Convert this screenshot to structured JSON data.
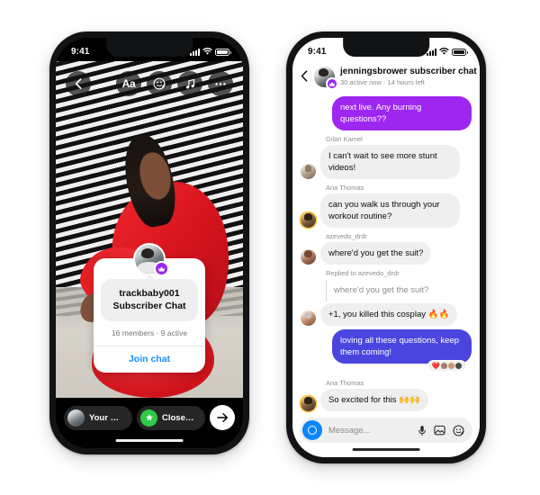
{
  "left_phone": {
    "status_bar": {
      "time": "9:41",
      "signal_icon": "cellular-bars-icon",
      "wifi_icon": "wifi-icon",
      "battery_icon": "battery-icon"
    },
    "story": {
      "back_icon": "chevron-left-icon",
      "tools": [
        {
          "name": "text-tool",
          "label": "Aa",
          "icon": "text-aa-icon"
        },
        {
          "name": "sticker-tool",
          "label": "",
          "icon": "sticker-smiley-icon"
        },
        {
          "name": "music-tool",
          "label": "",
          "icon": "music-note-icon"
        },
        {
          "name": "more-tool",
          "label": "",
          "icon": "more-dots-icon"
        }
      ],
      "card": {
        "avatar_badge_icon": "subscriber-crown-icon",
        "title_line1": "trackbaby001",
        "title_line2": "Subscriber Chat",
        "meta": "16 members · 9 active",
        "join_label": "Join chat"
      },
      "bottom_bar": {
        "your_story_label": "Your story",
        "close_friends_label": "Close friends",
        "close_friends_icon": "green-star-icon",
        "send_icon": "arrow-right-icon"
      }
    }
  },
  "right_phone": {
    "status_bar": {
      "time": "9:41",
      "signal_icon": "cellular-bars-icon",
      "wifi_icon": "wifi-icon",
      "battery_icon": "battery-icon"
    },
    "header": {
      "back_icon": "chevron-left-icon",
      "avatar_badge_icon": "subscriber-crown-icon",
      "title": "jenningsbrower subscriber chat",
      "subtitle": "30 active now · 14 hours left"
    },
    "messages": [
      {
        "type": "outgoing-top",
        "text": "next live. Any burning questions??"
      },
      {
        "type": "incoming",
        "sender": "Gilan Kamel",
        "text": "I can't wait to see more stunt videos!",
        "avatar": "avatar-gilan"
      },
      {
        "type": "incoming",
        "sender": "Ana Thomas",
        "text": "can you walk us through your workout routine?",
        "avatar": "avatar-ana"
      },
      {
        "type": "incoming",
        "sender": "azevedo_drdr",
        "text": "where'd you get the suit?",
        "avatar": "avatar-azevedo"
      },
      {
        "type": "reply",
        "reply_label": "Replied to azevedo_drdr",
        "quote": "where'd you get the suit?",
        "text": "+1, you killed this cosplay 🔥🔥",
        "avatar": "avatar-replier"
      },
      {
        "type": "outgoing",
        "text": "loving all these questions, keep them coming!",
        "reactions": "❤️"
      },
      {
        "type": "incoming",
        "sender": "Ana Thomas",
        "text": "So excited for this 🙌🙌",
        "avatar": "avatar-ana"
      }
    ],
    "input": {
      "camera_icon": "camera-icon",
      "placeholder": "Message...",
      "mic_icon": "microphone-icon",
      "gallery_icon": "image-icon",
      "sticker_icon": "sticker-smiley-icon"
    }
  },
  "colors": {
    "violet_bubble": "#9d27f0",
    "indigo_bubble": "#4b45e0",
    "link_blue": "#1a8cff",
    "camera_blue": "#0a86ff",
    "close_friends_green": "#2ec947",
    "incoming_grey": "#efefef"
  }
}
